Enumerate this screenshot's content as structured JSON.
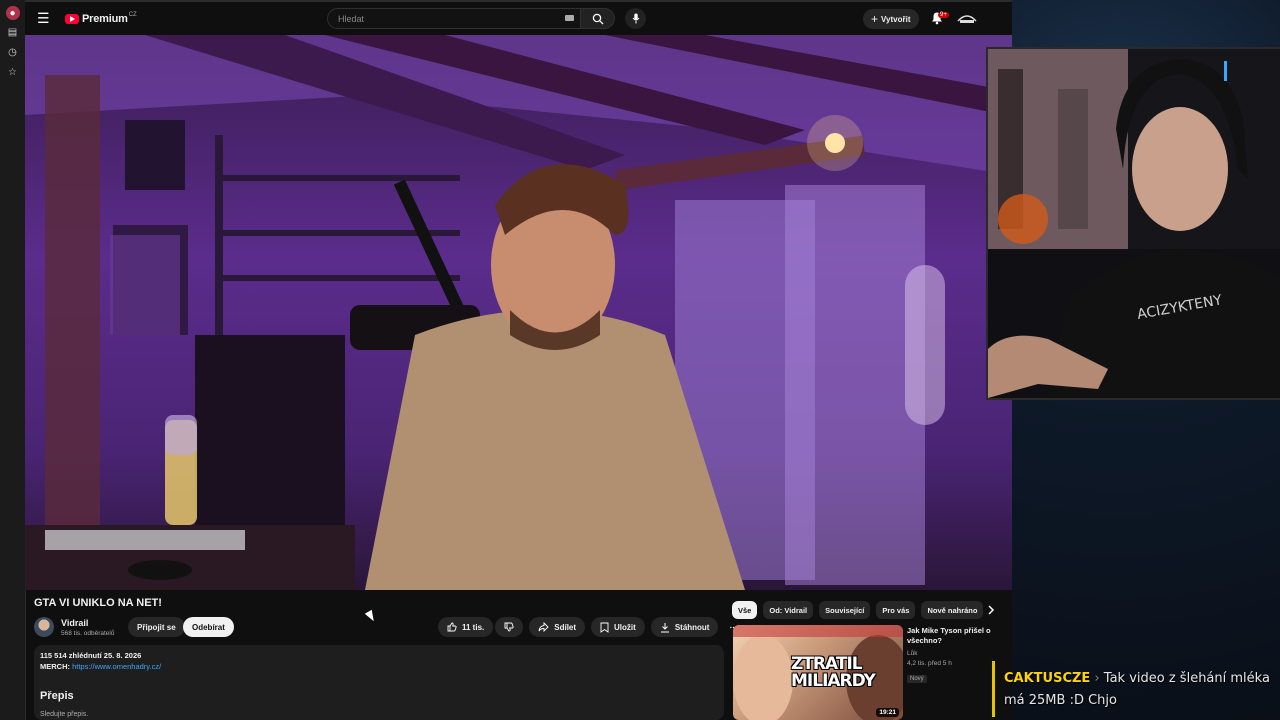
{
  "header": {
    "logo_text": "Premium",
    "logo_country": "CZ",
    "search_placeholder": "Hledat",
    "create_label": "Vytvořit",
    "notif_badge": "9+"
  },
  "video": {
    "title": "GTA VI UNIKLO NA NET!",
    "channel_name": "Vidrail",
    "channel_subs": "568 tis. odběratelů",
    "join_label": "Připojit se",
    "subscribe_label": "Odebírat",
    "likes": "11 tis.",
    "share_label": "Sdílet",
    "save_label": "Uložit",
    "download_label": "Stáhnout"
  },
  "description": {
    "stats": "115 514 zhlédnutí  25. 8. 2026",
    "merch_label": "MERCH: ",
    "merch_link": "https://www.omenhadry.cz/",
    "transcript_heading": "Přepis",
    "transcript_sub": "Sledujte přepis."
  },
  "chips": [
    "Vše",
    "Od: Vidrail",
    "Související",
    "Pro vás",
    "Nově nahráno"
  ],
  "recommendation": {
    "thumb_line1": "ZTRATIL",
    "thumb_line2": "MILIARDY",
    "duration": "19:21",
    "title": "Jak Mike Tyson přišel o všechno?",
    "channel": "Lůk",
    "meta": "4,2 tis.  před 5 h",
    "badge": "Nový"
  },
  "chat": {
    "username": "CAKTUSCZE",
    "message": "Tak video z šlehání mléka má 25MB :D Chjo"
  }
}
